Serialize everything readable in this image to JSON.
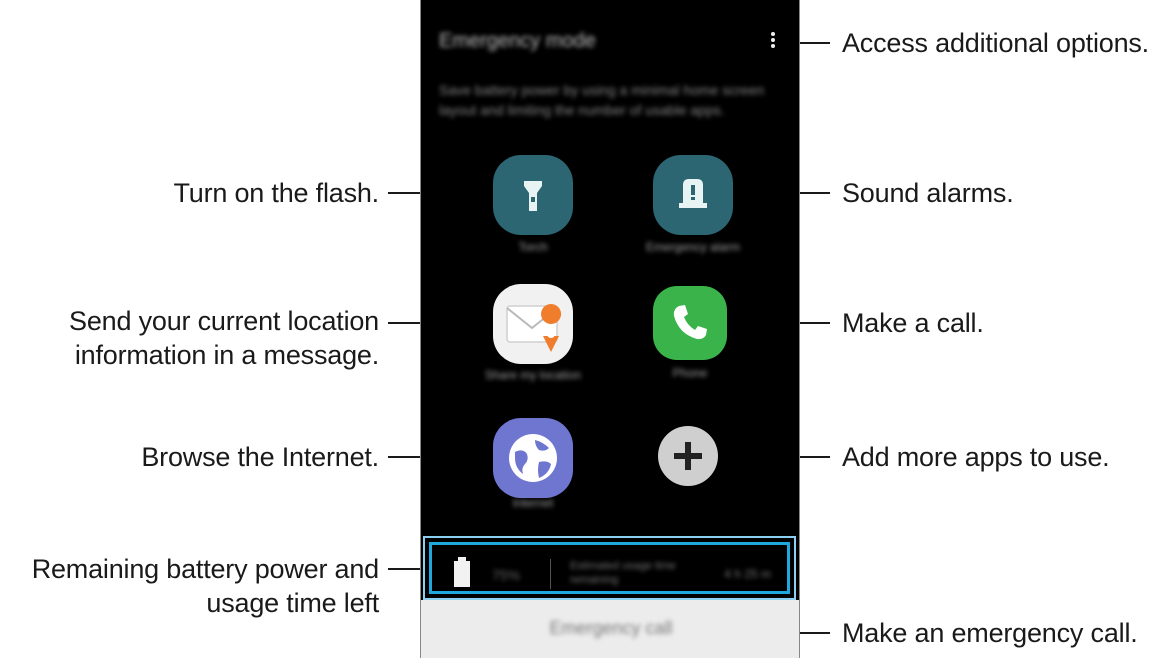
{
  "callouts": {
    "options": "Access additional options.",
    "flash": "Turn on the flash.",
    "alarms": "Sound alarms.",
    "location_l1": "Send your current location",
    "location_l2": "information in a message.",
    "call": "Make a call.",
    "internet": "Browse the Internet.",
    "add_apps": "Add more apps to use.",
    "battery_l1": "Remaining battery power and",
    "battery_l2": "usage time left",
    "emergency_call": "Make an emergency call."
  },
  "screen": {
    "title": "Emergency mode",
    "description": "Save battery power by using a minimal home screen layout and limiting the number of usable apps.",
    "apps": {
      "torch": "Torch",
      "alarm": "Emergency alarm",
      "share_location": "Share my location",
      "phone": "Phone",
      "internet": "Internet"
    },
    "battery": {
      "percent": "75%",
      "usage_label": "Estimated usage time remaining",
      "time": "4 h 25 m"
    },
    "emergency_button": "Emergency call"
  },
  "colors": {
    "screen_bg": "#000000",
    "teal_icon": "#2c6672",
    "phone_green": "#3ab34a",
    "internet_purple": "#6f76cf",
    "add_gray": "#cfcfcf",
    "highlight_blue": "#1fa7e0",
    "pin_orange": "#ef7d2c"
  },
  "icons": [
    "more-options-icon",
    "torch-icon",
    "alarm-icon",
    "share-location-icon",
    "phone-icon",
    "internet-icon",
    "add-icon",
    "battery-icon"
  ]
}
